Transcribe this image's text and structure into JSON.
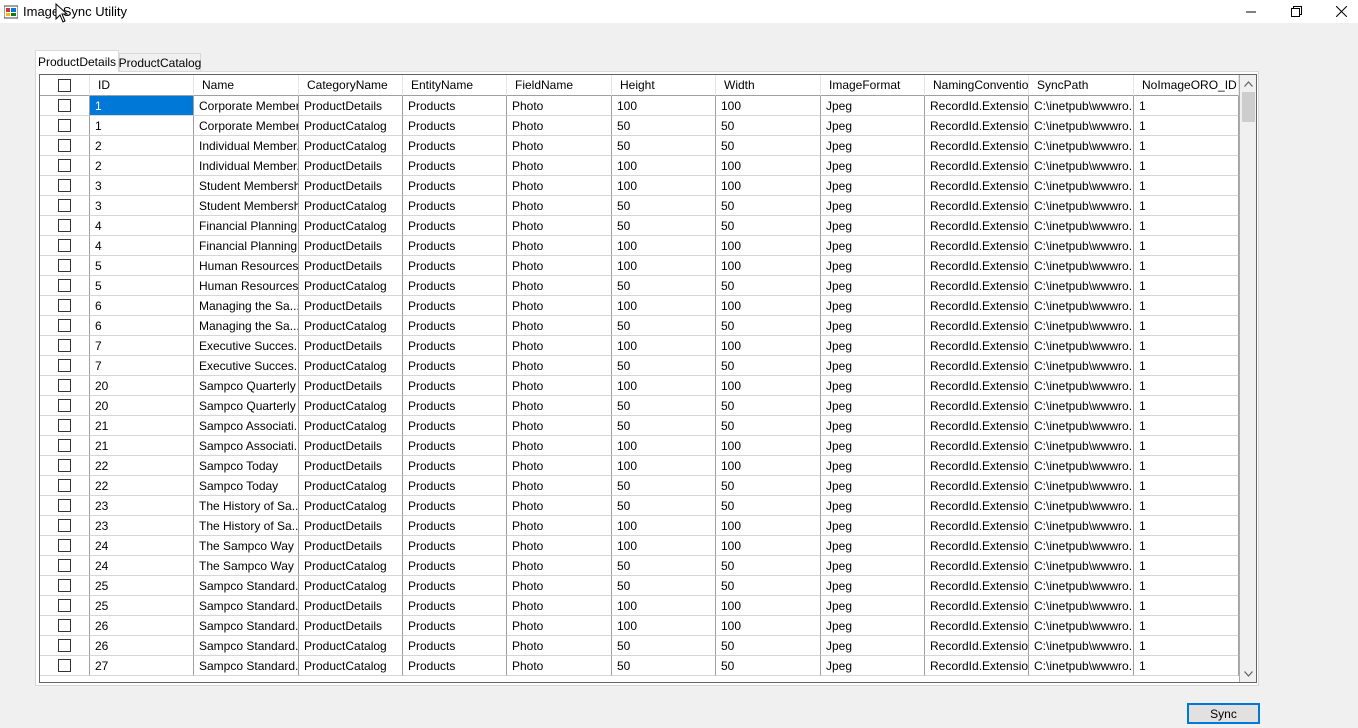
{
  "window": {
    "title": "Image Sync Utility",
    "minimize_icon": "minimize-icon",
    "maximize_icon": "restore-icon",
    "close_icon": "close-icon"
  },
  "tabs": [
    {
      "label": "ProductDetails",
      "active": true
    },
    {
      "label": "ProductCatalog",
      "active": false
    }
  ],
  "grid": {
    "columns": [
      "",
      "ID",
      "Name",
      "CategoryName",
      "EntityName",
      "FieldName",
      "Height",
      "Width",
      "ImageFormat",
      "NamingConvention",
      "SyncPath",
      "NoImageORO_ID"
    ],
    "rows": [
      [
        "1",
        "Corporate Member...",
        "ProductDetails",
        "Products",
        "Photo",
        "100",
        "100",
        "Jpeg",
        "RecordId.Extension",
        "C:\\inetpub\\wwwro...",
        "1"
      ],
      [
        "1",
        "Corporate Member...",
        "ProductCatalog",
        "Products",
        "Photo",
        "50",
        "50",
        "Jpeg",
        "RecordId.Extension",
        "C:\\inetpub\\wwwro...",
        "1"
      ],
      [
        "2",
        "Individual Member...",
        "ProductCatalog",
        "Products",
        "Photo",
        "50",
        "50",
        "Jpeg",
        "RecordId.Extension",
        "C:\\inetpub\\wwwro...",
        "1"
      ],
      [
        "2",
        "Individual Member...",
        "ProductDetails",
        "Products",
        "Photo",
        "100",
        "100",
        "Jpeg",
        "RecordId.Extension",
        "C:\\inetpub\\wwwro...",
        "1"
      ],
      [
        "3",
        "Student Membership",
        "ProductDetails",
        "Products",
        "Photo",
        "100",
        "100",
        "Jpeg",
        "RecordId.Extension",
        "C:\\inetpub\\wwwro...",
        "1"
      ],
      [
        "3",
        "Student Membership",
        "ProductCatalog",
        "Products",
        "Photo",
        "50",
        "50",
        "Jpeg",
        "RecordId.Extension",
        "C:\\inetpub\\wwwro...",
        "1"
      ],
      [
        "4",
        "Financial Planning",
        "ProductCatalog",
        "Products",
        "Photo",
        "50",
        "50",
        "Jpeg",
        "RecordId.Extension",
        "C:\\inetpub\\wwwro...",
        "1"
      ],
      [
        "4",
        "Financial Planning",
        "ProductDetails",
        "Products",
        "Photo",
        "100",
        "100",
        "Jpeg",
        "RecordId.Extension",
        "C:\\inetpub\\wwwro...",
        "1"
      ],
      [
        "5",
        "Human Resources...",
        "ProductDetails",
        "Products",
        "Photo",
        "100",
        "100",
        "Jpeg",
        "RecordId.Extension",
        "C:\\inetpub\\wwwro...",
        "1"
      ],
      [
        "5",
        "Human Resources...",
        "ProductCatalog",
        "Products",
        "Photo",
        "50",
        "50",
        "Jpeg",
        "RecordId.Extension",
        "C:\\inetpub\\wwwro...",
        "1"
      ],
      [
        "6",
        "Managing the Sa...",
        "ProductDetails",
        "Products",
        "Photo",
        "100",
        "100",
        "Jpeg",
        "RecordId.Extension",
        "C:\\inetpub\\wwwro...",
        "1"
      ],
      [
        "6",
        "Managing the Sa...",
        "ProductCatalog",
        "Products",
        "Photo",
        "50",
        "50",
        "Jpeg",
        "RecordId.Extension",
        "C:\\inetpub\\wwwro...",
        "1"
      ],
      [
        "7",
        "Executive Succes...",
        "ProductDetails",
        "Products",
        "Photo",
        "100",
        "100",
        "Jpeg",
        "RecordId.Extension",
        "C:\\inetpub\\wwwro...",
        "1"
      ],
      [
        "7",
        "Executive Succes...",
        "ProductCatalog",
        "Products",
        "Photo",
        "50",
        "50",
        "Jpeg",
        "RecordId.Extension",
        "C:\\inetpub\\wwwro...",
        "1"
      ],
      [
        "20",
        "Sampco Quarterly",
        "ProductDetails",
        "Products",
        "Photo",
        "100",
        "100",
        "Jpeg",
        "RecordId.Extension",
        "C:\\inetpub\\wwwro...",
        "1"
      ],
      [
        "20",
        "Sampco Quarterly",
        "ProductCatalog",
        "Products",
        "Photo",
        "50",
        "50",
        "Jpeg",
        "RecordId.Extension",
        "C:\\inetpub\\wwwro...",
        "1"
      ],
      [
        "21",
        "Sampco Associati...",
        "ProductCatalog",
        "Products",
        "Photo",
        "50",
        "50",
        "Jpeg",
        "RecordId.Extension",
        "C:\\inetpub\\wwwro...",
        "1"
      ],
      [
        "21",
        "Sampco Associati...",
        "ProductDetails",
        "Products",
        "Photo",
        "100",
        "100",
        "Jpeg",
        "RecordId.Extension",
        "C:\\inetpub\\wwwro...",
        "1"
      ],
      [
        "22",
        "Sampco Today",
        "ProductDetails",
        "Products",
        "Photo",
        "100",
        "100",
        "Jpeg",
        "RecordId.Extension",
        "C:\\inetpub\\wwwro...",
        "1"
      ],
      [
        "22",
        "Sampco Today",
        "ProductCatalog",
        "Products",
        "Photo",
        "50",
        "50",
        "Jpeg",
        "RecordId.Extension",
        "C:\\inetpub\\wwwro...",
        "1"
      ],
      [
        "23",
        "The History of Sa...",
        "ProductCatalog",
        "Products",
        "Photo",
        "50",
        "50",
        "Jpeg",
        "RecordId.Extension",
        "C:\\inetpub\\wwwro...",
        "1"
      ],
      [
        "23",
        "The History of Sa...",
        "ProductDetails",
        "Products",
        "Photo",
        "100",
        "100",
        "Jpeg",
        "RecordId.Extension",
        "C:\\inetpub\\wwwro...",
        "1"
      ],
      [
        "24",
        "The Sampco Way",
        "ProductDetails",
        "Products",
        "Photo",
        "100",
        "100",
        "Jpeg",
        "RecordId.Extension",
        "C:\\inetpub\\wwwro...",
        "1"
      ],
      [
        "24",
        "The Sampco Way",
        "ProductCatalog",
        "Products",
        "Photo",
        "50",
        "50",
        "Jpeg",
        "RecordId.Extension",
        "C:\\inetpub\\wwwro...",
        "1"
      ],
      [
        "25",
        "Sampco Standard...",
        "ProductCatalog",
        "Products",
        "Photo",
        "50",
        "50",
        "Jpeg",
        "RecordId.Extension",
        "C:\\inetpub\\wwwro...",
        "1"
      ],
      [
        "25",
        "Sampco Standard...",
        "ProductDetails",
        "Products",
        "Photo",
        "100",
        "100",
        "Jpeg",
        "RecordId.Extension",
        "C:\\inetpub\\wwwro...",
        "1"
      ],
      [
        "26",
        "Sampco Standard...",
        "ProductDetails",
        "Products",
        "Photo",
        "100",
        "100",
        "Jpeg",
        "RecordId.Extension",
        "C:\\inetpub\\wwwro...",
        "1"
      ],
      [
        "26",
        "Sampco Standard...",
        "ProductCatalog",
        "Products",
        "Photo",
        "50",
        "50",
        "Jpeg",
        "RecordId.Extension",
        "C:\\inetpub\\wwwro...",
        "1"
      ],
      [
        "27",
        "Sampco Standard...",
        "ProductCatalog",
        "Products",
        "Photo",
        "50",
        "50",
        "Jpeg",
        "RecordId.Extension",
        "C:\\inetpub\\wwwro...",
        "1"
      ]
    ]
  },
  "actions": {
    "sync_label": "Sync"
  },
  "colors": {
    "selection": "#0078d7",
    "button_border": "#0078d7"
  }
}
